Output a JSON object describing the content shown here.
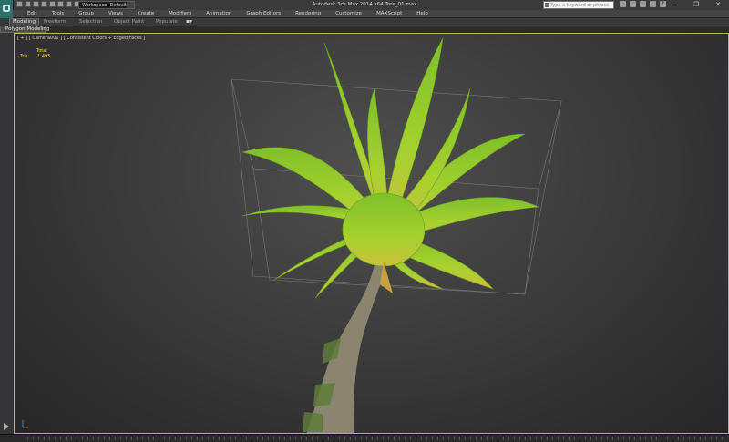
{
  "window": {
    "title": "Autodesk 3ds Max  2014 x64     Tree_01.max",
    "workspace_label": "Workspace: Default",
    "search_placeholder": "Type a keyword or phrase",
    "min": "–",
    "max": "❐",
    "close": "✕"
  },
  "menu": [
    "Edit",
    "Tools",
    "Group",
    "Views",
    "Create",
    "Modifiers",
    "Animation",
    "Graph Editors",
    "Rendering",
    "Customize",
    "MAXScript",
    "Help"
  ],
  "ribbon": {
    "tabs": [
      "Modeling",
      "Freeform",
      "Selection",
      "Object Paint",
      "Populate"
    ],
    "panel_label": "Polygon Modeling"
  },
  "viewport": {
    "label": "[ + ] [ Camera001 ] [ Consistent Colors + Edged Faces ]",
    "stats_header": "Total",
    "stats_label": "Tris:",
    "stats_value": "1 495"
  },
  "colors": {
    "viewport_border": "#bdb36a",
    "stats_text": "#ffd23a",
    "frond_green": "#9bd12a",
    "trunk": "#8a8570"
  }
}
